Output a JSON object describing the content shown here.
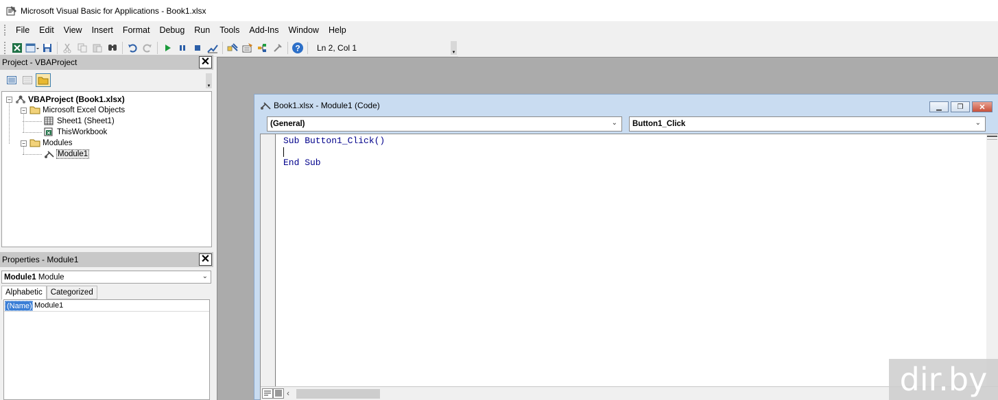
{
  "window": {
    "title": "Microsoft Visual Basic for Applications - Book1.xlsx"
  },
  "menu": [
    "File",
    "Edit",
    "View",
    "Insert",
    "Format",
    "Debug",
    "Run",
    "Tools",
    "Add-Ins",
    "Window",
    "Help"
  ],
  "toolbar": {
    "icons": [
      "excel-view-icon",
      "insert-userform-icon",
      "save-icon",
      "cut-icon",
      "copy-icon",
      "paste-icon",
      "find-icon",
      "undo-icon",
      "redo-icon",
      "run-icon",
      "break-icon",
      "reset-icon",
      "design-mode-icon",
      "project-explorer-icon",
      "properties-icon",
      "object-browser-icon",
      "toolbox-icon",
      "help-icon"
    ],
    "status": "Ln 2, Col 1"
  },
  "project_pane": {
    "title": "Project - VBAProject",
    "tree": {
      "root": "VBAProject (Book1.xlsx)",
      "excel_objects": "Microsoft Excel Objects",
      "sheet1": "Sheet1 (Sheet1)",
      "thisworkbook": "ThisWorkbook",
      "modules": "Modules",
      "module1": "Module1"
    }
  },
  "properties_pane": {
    "title": "Properties - Module1",
    "object_name": "Module1",
    "object_type": "Module",
    "tabs": [
      "Alphabetic",
      "Categorized"
    ],
    "rows": [
      {
        "name": "(Name)",
        "value": "Module1"
      }
    ]
  },
  "code_window": {
    "title": "Book1.xlsx - Module1 (Code)",
    "object_combo": "(General)",
    "procedure_combo": "Button1_Click",
    "lines": [
      "Sub Button1_Click()",
      "",
      "End Sub"
    ]
  },
  "watermark": "dir.by",
  "colors": {
    "workspace": "#ababab",
    "code_keyword": "#00008b",
    "selection": "#3a7ed6"
  }
}
